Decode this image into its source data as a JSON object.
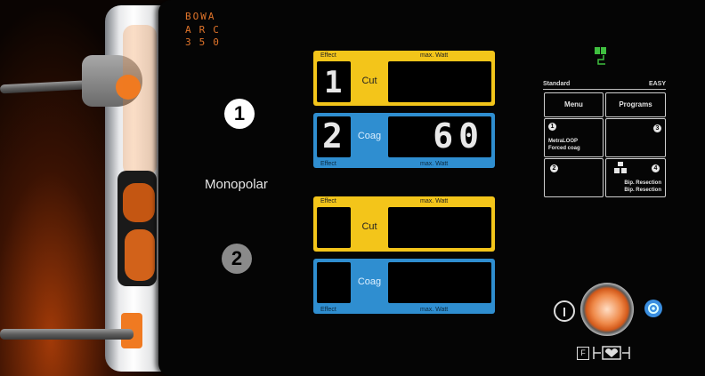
{
  "brand": {
    "line1": "BOWA",
    "line2": "ARC",
    "line3": "350"
  },
  "channels": [
    {
      "number": "1",
      "mode_label": "Monopolar",
      "cut": {
        "effect_label": "Effect",
        "watt_label": "max. Watt",
        "effect": "1",
        "mode": "Cut",
        "watt": ""
      },
      "coag": {
        "effect_label": "Effect",
        "watt_label": "max. Watt",
        "effect": "2",
        "mode": "Coag",
        "watt": "60"
      }
    },
    {
      "number": "2",
      "cut": {
        "effect_label": "Effect",
        "watt_label": "max. Watt",
        "effect": "",
        "mode": "Cut",
        "watt": ""
      },
      "coag": {
        "effect_label": "Effect",
        "watt_label": "max. Watt",
        "effect": "",
        "mode": "Coag",
        "watt": ""
      }
    }
  ],
  "menu": {
    "standard_label": "Standard",
    "easy_label": "EASY",
    "menu_button": "Menu",
    "programs_button": "Programs",
    "slot1": {
      "number": "1",
      "line1": "MetraLOOP",
      "line2": "Forced coag"
    },
    "slot2": {
      "number": "2"
    },
    "slot3": {
      "number": "3"
    },
    "slot4": {
      "number": "4",
      "line1": "Bip. Resection",
      "line2": "Bip. Resection"
    }
  },
  "controls": {
    "power_symbol": "⏻",
    "footswitch_label": "F",
    "colors": {
      "accent": "#f07a21",
      "display_yellow": "#f3c51a",
      "display_blue": "#2f8ed0"
    }
  }
}
